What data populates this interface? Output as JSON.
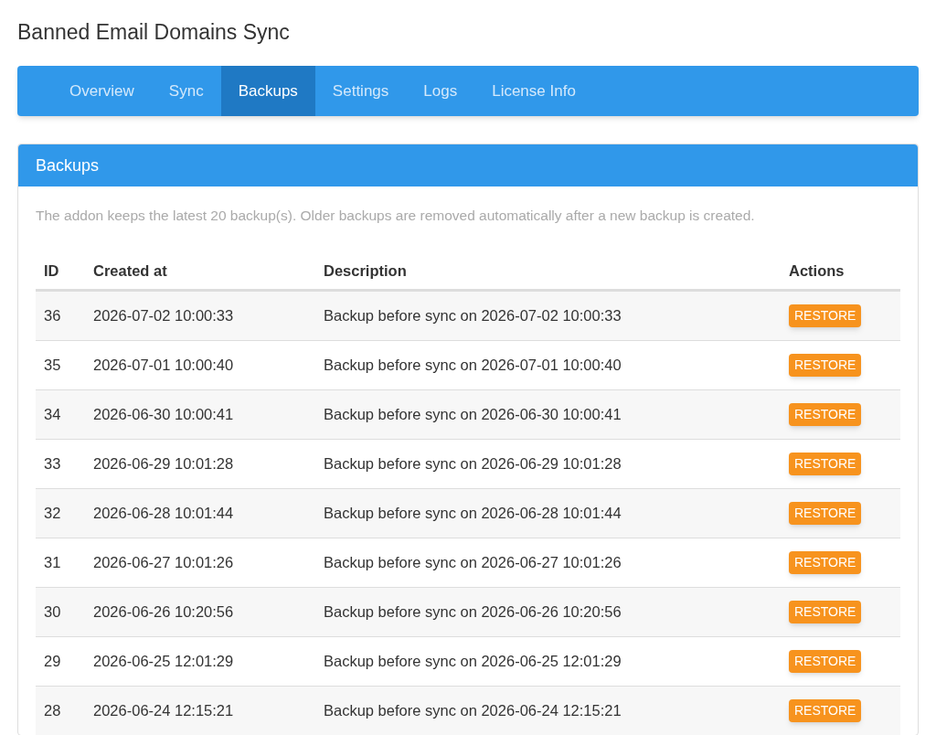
{
  "page_title": "Banned Email Domains Sync",
  "tabs": [
    {
      "label": "Overview",
      "selected": false
    },
    {
      "label": "Sync",
      "selected": false
    },
    {
      "label": "Backups",
      "selected": true
    },
    {
      "label": "Settings",
      "selected": false
    },
    {
      "label": "Logs",
      "selected": false
    },
    {
      "label": "License Info",
      "selected": false
    }
  ],
  "panel": {
    "title": "Backups",
    "note": "The addon keeps the latest 20 backup(s). Older backups are removed automatically after a new backup is created."
  },
  "table": {
    "columns": [
      "ID",
      "Created at",
      "Description",
      "Actions"
    ],
    "rows": [
      {
        "id": "36",
        "created_at": "2026-07-02 10:00:33",
        "description": "Backup before sync on 2026-07-02 10:00:33",
        "action": "RESTORE"
      },
      {
        "id": "35",
        "created_at": "2026-07-01 10:00:40",
        "description": "Backup before sync on 2026-07-01 10:00:40",
        "action": "RESTORE"
      },
      {
        "id": "34",
        "created_at": "2026-06-30 10:00:41",
        "description": "Backup before sync on 2026-06-30 10:00:41",
        "action": "RESTORE"
      },
      {
        "id": "33",
        "created_at": "2026-06-29 10:01:28",
        "description": "Backup before sync on 2026-06-29 10:01:28",
        "action": "RESTORE"
      },
      {
        "id": "32",
        "created_at": "2026-06-28 10:01:44",
        "description": "Backup before sync on 2026-06-28 10:01:44",
        "action": "RESTORE"
      },
      {
        "id": "31",
        "created_at": "2026-06-27 10:01:26",
        "description": "Backup before sync on 2026-06-27 10:01:26",
        "action": "RESTORE"
      },
      {
        "id": "30",
        "created_at": "2026-06-26 10:20:56",
        "description": "Backup before sync on 2026-06-26 10:20:56",
        "action": "RESTORE"
      },
      {
        "id": "29",
        "created_at": "2026-06-25 12:01:29",
        "description": "Backup before sync on 2026-06-25 12:01:29",
        "action": "RESTORE"
      },
      {
        "id": "28",
        "created_at": "2026-06-24 12:15:21",
        "description": "Backup before sync on 2026-06-24 12:15:21",
        "action": "RESTORE"
      }
    ]
  }
}
